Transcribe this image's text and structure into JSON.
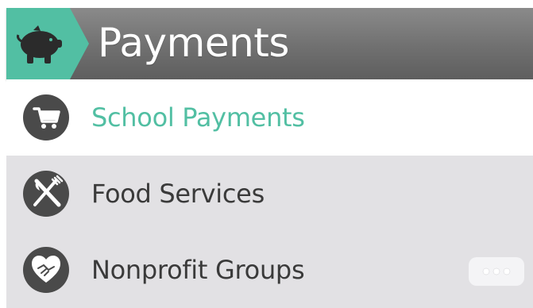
{
  "header": {
    "title": "Payments",
    "icon": "piggy-bank-icon",
    "accent_color": "#52bfa3"
  },
  "menu": {
    "items": [
      {
        "label": "School Payments",
        "icon": "shopping-cart-icon",
        "selected": true
      },
      {
        "label": "Food Services",
        "icon": "fork-knife-icon",
        "selected": false
      },
      {
        "label": "Nonprofit Groups",
        "icon": "heart-handshake-icon",
        "selected": false,
        "has_more": true
      }
    ]
  },
  "colors": {
    "selected_text": "#52bfa3",
    "row_background": "#e2e1e4",
    "icon_circle": "#4a4a4a"
  }
}
